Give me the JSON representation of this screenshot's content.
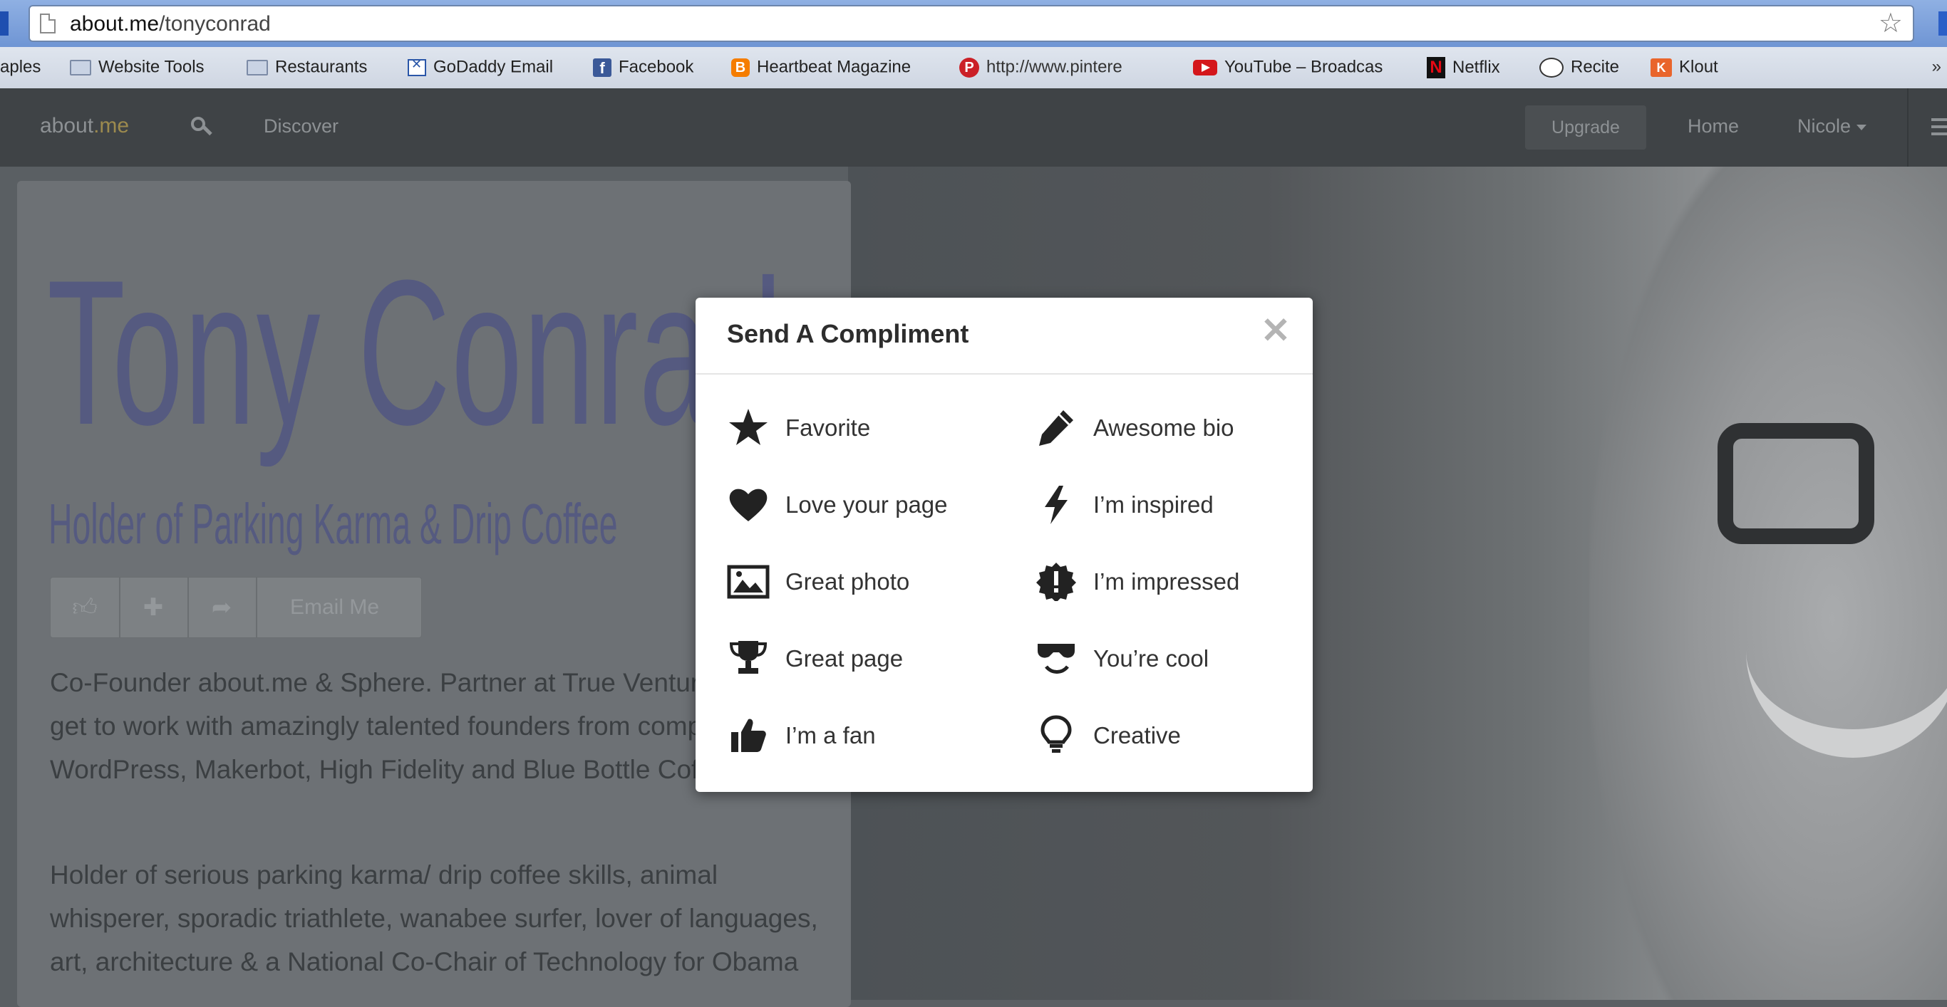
{
  "browser": {
    "url_domain": "about.me",
    "url_path": "/tonyconrad",
    "bookmarks": [
      {
        "label": "aples",
        "icon": "none"
      },
      {
        "label": "Website Tools",
        "icon": "folder-icon"
      },
      {
        "label": "Restaurants",
        "icon": "folder-icon"
      },
      {
        "label": "GoDaddy Email",
        "icon": "mail-icon"
      },
      {
        "label": "Facebook",
        "icon": "facebook-icon"
      },
      {
        "label": "Heartbeat Magazine",
        "icon": "blogger-icon"
      },
      {
        "label": "http://www.pintere",
        "icon": "pinterest-icon"
      },
      {
        "label": "YouTube – Broadcas",
        "icon": "youtube-icon"
      },
      {
        "label": "Netflix",
        "icon": "netflix-icon"
      },
      {
        "label": "Recite",
        "icon": "recite-icon"
      },
      {
        "label": "Klout",
        "icon": "klout-icon"
      }
    ],
    "overflow": "»"
  },
  "nav": {
    "logo_about": "about",
    "logo_dot": ".",
    "logo_me": "me",
    "discover": "Discover",
    "upgrade": "Upgrade",
    "home": "Home",
    "user": "Nicole"
  },
  "profile": {
    "name": "Tony Conrad",
    "headline": "Holder of Parking Karma & Drip Coffee",
    "email_button": "Email Me",
    "bio_1": "Co-Founder about.me & Sphere. Partner at True Ventures where I get to work with amazingly talented founders from companies like WordPress, Makerbot, High Fidelity and Blue Bottle Coffee.",
    "bio_2": "Holder of serious parking karma/ drip coffee skills, animal whisperer, sporadic triathlete, wanabee surfer, lover of languages, art, architecture & a National Co-Chair of Technology for Obama"
  },
  "modal": {
    "title": "Send A Compliment",
    "close": "✕",
    "options_left": [
      {
        "label": "Favorite",
        "icon": "star-icon"
      },
      {
        "label": "Love your page",
        "icon": "heart-icon"
      },
      {
        "label": "Great photo",
        "icon": "photo-icon"
      },
      {
        "label": "Great page",
        "icon": "trophy-icon"
      },
      {
        "label": "I’m a fan",
        "icon": "thumbs-up-icon"
      }
    ],
    "options_right": [
      {
        "label": "Awesome bio",
        "icon": "pencil-icon"
      },
      {
        "label": "I’m inspired",
        "icon": "lightning-icon"
      },
      {
        "label": "I’m impressed",
        "icon": "exclamation-badge-icon"
      },
      {
        "label": "You’re cool",
        "icon": "sunglasses-icon"
      },
      {
        "label": "Creative",
        "icon": "lightbulb-icon"
      }
    ]
  }
}
